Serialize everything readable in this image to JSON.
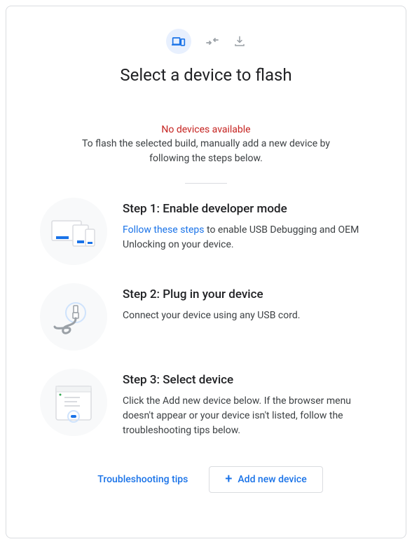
{
  "header": {
    "title": "Select a device to flash"
  },
  "status": {
    "error": "No devices available",
    "description": "To flash the selected build, manually add a new device by following the steps below."
  },
  "steps": [
    {
      "title": "Step 1: Enable developer mode",
      "link_text": "Follow these steps",
      "desc_after_link": " to enable USB Debugging and OEM Unlocking on your device."
    },
    {
      "title": "Step 2: Plug in your device",
      "desc": "Connect your device using any USB cord."
    },
    {
      "title": "Step 3: Select device",
      "desc": "Click the Add new device below. If the browser menu doesn't appear or your device isn't listed, follow the troubleshooting tips below."
    }
  ],
  "actions": {
    "troubleshoot": "Troubleshooting tips",
    "add_device": "Add new device"
  }
}
